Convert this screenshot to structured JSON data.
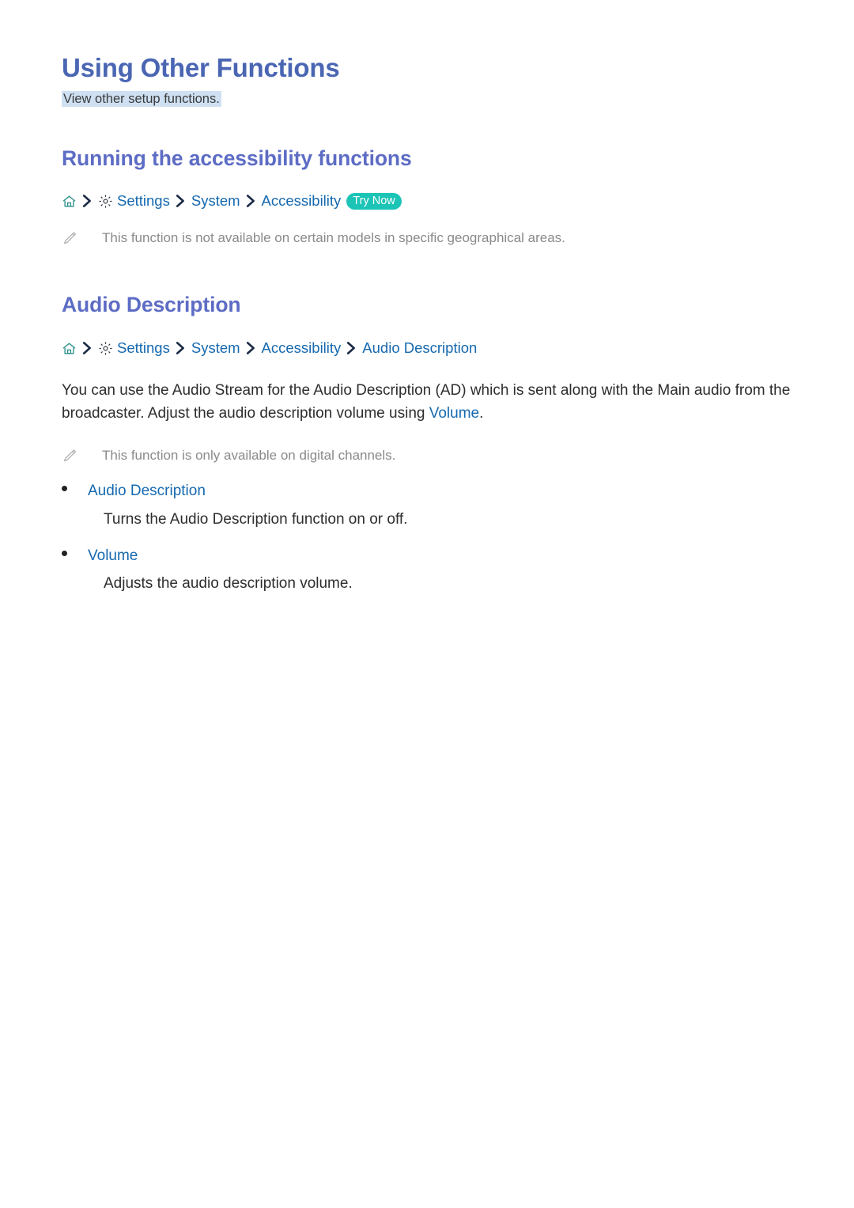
{
  "colors": {
    "title": "#4a66b3",
    "heading": "#5d6cc4",
    "link": "#1569b0",
    "badge_bg": "#1cc4b6",
    "badge_text": "#ffffff",
    "highlight_bg": "#cfe0f2",
    "note_text": "#8a8a8a",
    "body_text": "#2d2d2d",
    "home_icon": "#2b8f8a",
    "gear_icon": "#333b47",
    "chevron": "#1b2a45",
    "pencil_icon": "#b0b0b0"
  },
  "page": {
    "title": "Using Other Functions",
    "subtitle": "View other setup functions."
  },
  "section_accessibility": {
    "heading": "Running the accessibility functions",
    "breadcrumb": {
      "home_icon": "home-icon",
      "gear_icon": "gear-icon",
      "separator_icon": "chevron-right-icon",
      "crumbs": [
        "Settings",
        "System",
        "Accessibility"
      ],
      "badge": "Try Now"
    },
    "note": {
      "icon": "pencil-icon",
      "text": "This function is not available on certain models in specific geographical areas."
    }
  },
  "section_audio_description": {
    "heading": "Audio Description",
    "breadcrumb": {
      "home_icon": "home-icon",
      "gear_icon": "gear-icon",
      "separator_icon": "chevron-right-icon",
      "crumbs": [
        "Settings",
        "System",
        "Accessibility",
        "Audio Description"
      ]
    },
    "paragraph": {
      "part1": "You can use the Audio Stream for the Audio Description (AD) which is sent along with the Main audio from the broadcaster. Adjust the audio description volume using ",
      "link": "Volume",
      "part2": "."
    },
    "note": {
      "icon": "pencil-icon",
      "text": "This function is only available on digital channels."
    },
    "options": [
      {
        "label": "Audio Description",
        "description": "Turns the Audio Description function on or off."
      },
      {
        "label": "Volume",
        "description": "Adjusts the audio description volume."
      }
    ]
  }
}
